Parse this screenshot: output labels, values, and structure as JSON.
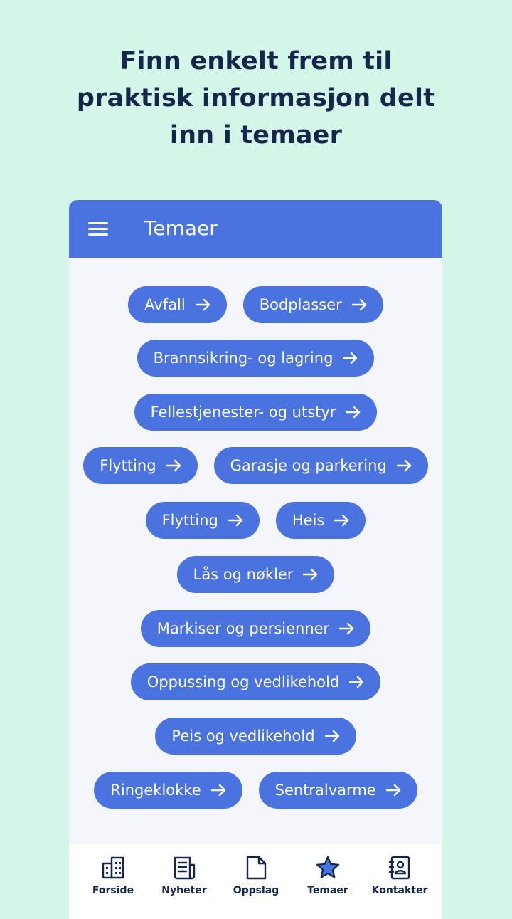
{
  "headline": {
    "line1": "Finn enkelt frem til",
    "line2": "praktisk informasjon delt",
    "line3": "inn i temaer"
  },
  "app": {
    "title": "Temaer"
  },
  "topics": [
    [
      "Avfall",
      "Bodplasser"
    ],
    [
      "Brannsikring- og lagring"
    ],
    [
      "Fellestjenester- og utstyr"
    ],
    [
      "Flytting",
      "Garasje og parkering"
    ],
    [
      "Flytting",
      "Heis"
    ],
    [
      "Lås og nøkler"
    ],
    [
      "Markiser og persienner"
    ],
    [
      "Oppussing og vedlikehold"
    ],
    [
      "Peis og vedlikehold"
    ],
    [
      "Ringeklokke",
      "Sentralvarme"
    ]
  ],
  "nav": [
    {
      "label": "Forside",
      "icon": "building-icon"
    },
    {
      "label": "Nyheter",
      "icon": "newspaper-icon"
    },
    {
      "label": "Oppslag",
      "icon": "document-icon"
    },
    {
      "label": "Temaer",
      "icon": "star-icon",
      "active": true
    },
    {
      "label": "Kontakter",
      "icon": "contacts-icon"
    }
  ],
  "colors": {
    "background": "#d3f6e8",
    "primary": "#4a73e0",
    "text_dark": "#14264a",
    "card": "#f4f6fc"
  }
}
